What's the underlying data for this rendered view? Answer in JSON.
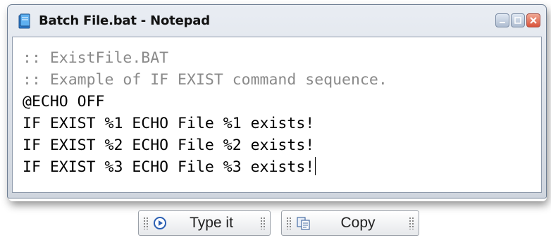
{
  "window": {
    "title": "Batch File.bat - Notepad",
    "icon": "notepad-icon"
  },
  "editor": {
    "lines": [
      ":: ExistFile.BAT",
      ":: Example of IF EXIST command sequence.",
      "@ECHO OFF",
      "IF EXIST %1 ECHO File %1 exists!",
      "IF EXIST %2 ECHO File %2 exists!",
      "IF EXIST %3 ECHO File %3 exists!"
    ]
  },
  "buttons": {
    "type_it": {
      "label": "Type it",
      "icon": "play-icon"
    },
    "copy": {
      "label": "Copy",
      "icon": "copy-icon"
    }
  },
  "colors": {
    "comment": "#8a8a8a",
    "code": "#000000"
  }
}
